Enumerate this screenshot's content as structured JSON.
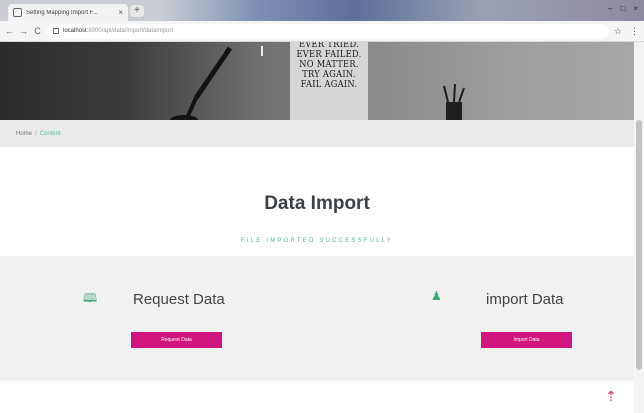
{
  "browser": {
    "tab_title": "Setting Mapping Import F...",
    "tab_close": "×",
    "new_tab": "+",
    "url_host": "localhost",
    "url_path": ":8000/api/data/import/dataimport",
    "controls": [
      "–",
      "□",
      "×"
    ],
    "nav": [
      "←",
      "→",
      "C"
    ],
    "right_icons": [
      "☆",
      "⋮"
    ]
  },
  "hero": {
    "poster_lines": [
      "EVER TRIED.",
      "EVER FAILED.",
      "NO MATTER.",
      "TRY AGAIN.",
      "FAIL AGAIN."
    ]
  },
  "breadcrumb": {
    "home": "Home",
    "separator": "/",
    "current": "Content"
  },
  "page": {
    "title": "Data Import",
    "status": "FILE IMPORTED SUCCESSFULLY"
  },
  "cards": [
    {
      "icon": "map-icon",
      "icon_glyph": "🕮",
      "title": "Request Data",
      "button": "Request Data"
    },
    {
      "icon": "person-icon",
      "icon_glyph": "♟",
      "title": "import Data",
      "button": "Import Data"
    }
  ],
  "scroll_top": {
    "icon": "arrow-up-icon",
    "glyph": "⇡"
  },
  "colors": {
    "accent": "#d1157e",
    "success": "#5fb88a",
    "icon": "#47a574"
  }
}
